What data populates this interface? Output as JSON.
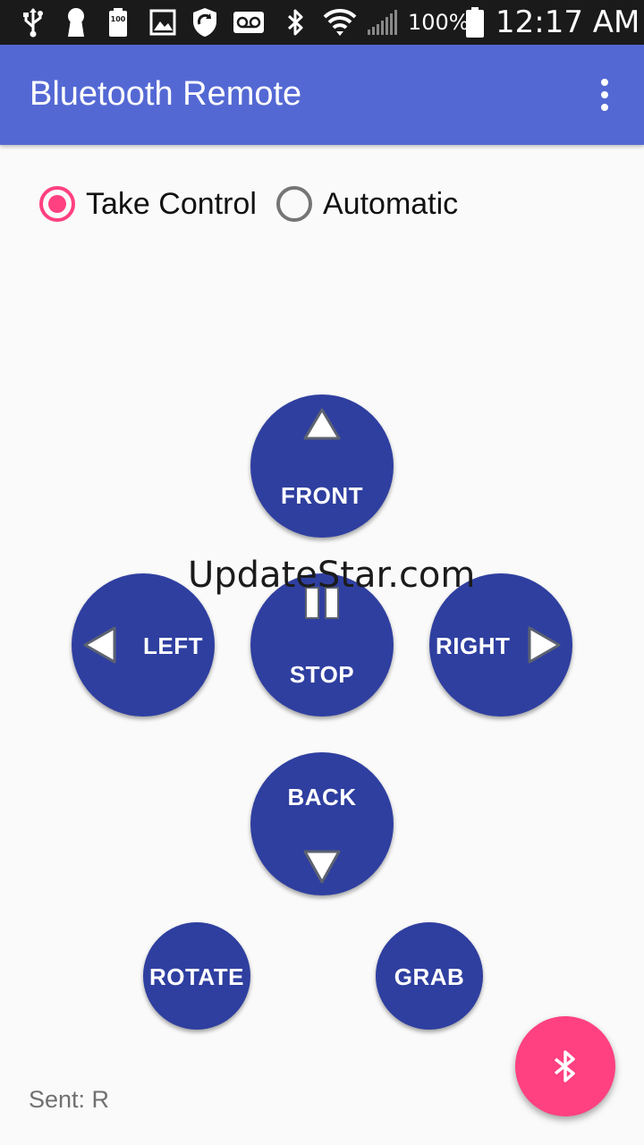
{
  "status_bar": {
    "battery_percent": "100%",
    "time": "12:17 AM",
    "icons": [
      "usb-icon",
      "keyhole-icon",
      "battery-saver-icon",
      "gallery-icon",
      "shield-refresh-icon",
      "voicemail-icon",
      "bluetooth-icon",
      "wifi-icon",
      "signal-icon",
      "battery-icon"
    ],
    "battery_badge": "100"
  },
  "app_bar": {
    "title": "Bluetooth Remote",
    "menu_icon": "overflow-menu-icon"
  },
  "mode": {
    "options": [
      {
        "label": "Take Control",
        "checked": true
      },
      {
        "label": "Automatic",
        "checked": false
      }
    ]
  },
  "controls": {
    "front": "FRONT",
    "left": "LEFT",
    "stop": "STOP",
    "right": "RIGHT",
    "back": "BACK",
    "rotate": "ROTATE",
    "grab": "GRAB"
  },
  "watermark": "UpdateStar.com",
  "sent": "Sent: R",
  "fab": {
    "icon": "bluetooth-icon"
  },
  "colors": {
    "status_bar": "#1a1a1a",
    "app_bar": "#5468d4",
    "control_button": "#2f3fa0",
    "accent": "#ff4081",
    "background": "#fafafa"
  }
}
